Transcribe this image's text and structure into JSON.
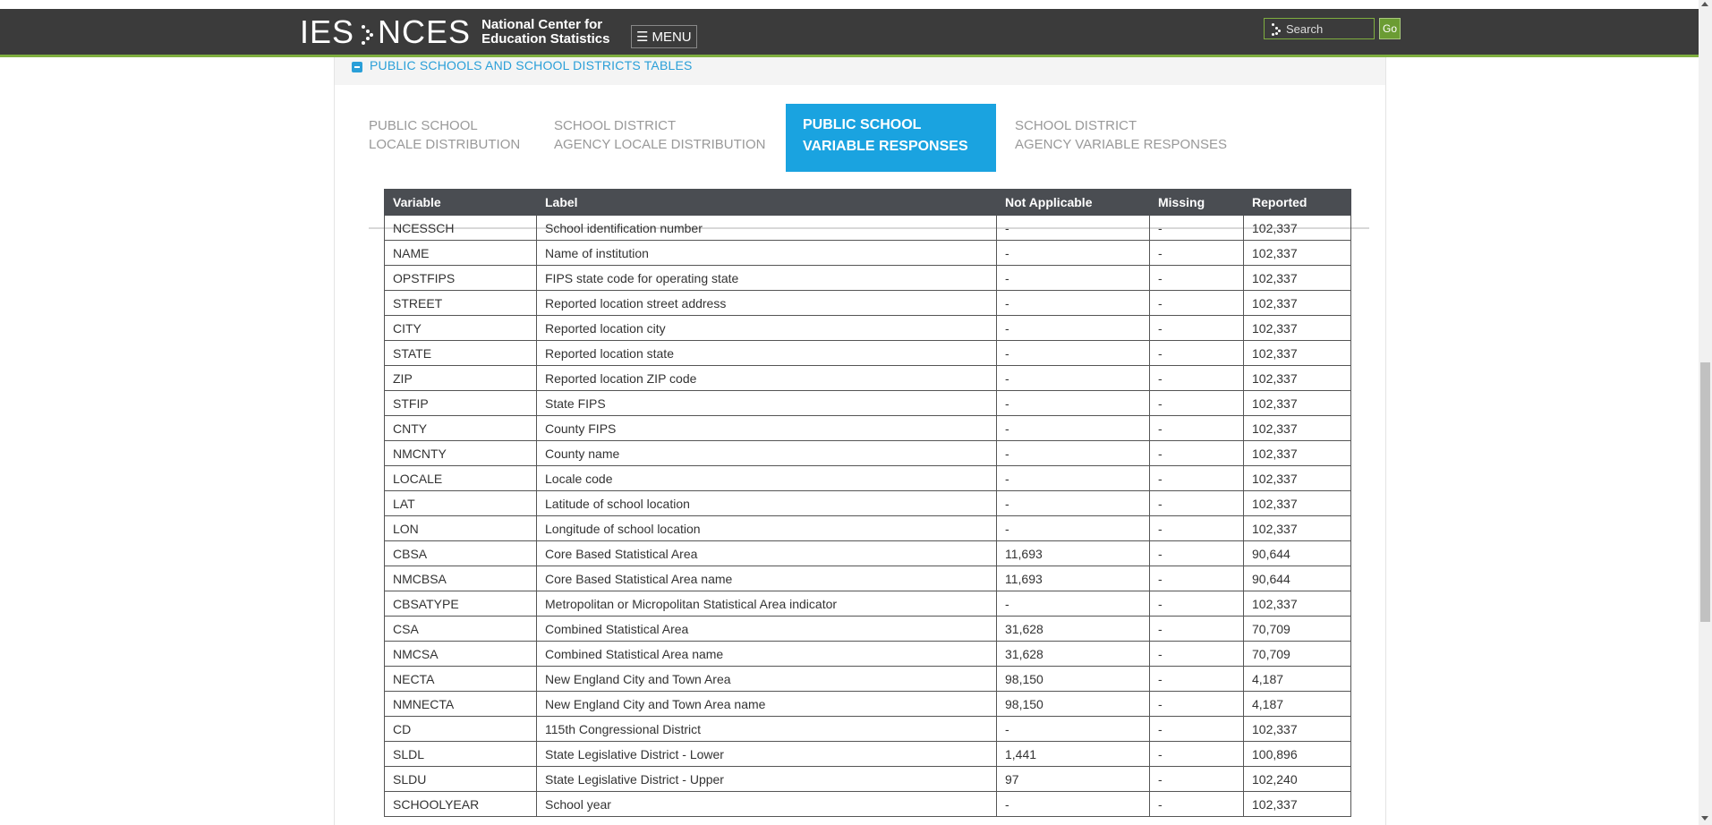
{
  "header": {
    "logo_ies": "IES",
    "logo_nces": "NCES",
    "logo_line1": "National Center for",
    "logo_line2": "Education Statistics",
    "menu_label": "MENU",
    "search_placeholder": "Search",
    "go_label": "Go"
  },
  "section": {
    "title": "PUBLIC SCHOOLS AND SCHOOL DISTRICTS TABLES"
  },
  "tabs": [
    {
      "line1": "PUBLIC SCHOOL",
      "line2": "LOCALE DISTRIBUTION",
      "active": false
    },
    {
      "line1": "SCHOOL DISTRICT",
      "line2": "AGENCY LOCALE DISTRIBUTION",
      "active": false
    },
    {
      "line1": "PUBLIC SCHOOL",
      "line2": "VARIABLE RESPONSES",
      "active": true
    },
    {
      "line1": "SCHOOL DISTRICT",
      "line2": "AGENCY VARIABLE RESPONSES",
      "active": false
    }
  ],
  "table": {
    "headers": [
      "Variable",
      "Label",
      "Not Applicable",
      "Missing",
      "Reported"
    ],
    "rows": [
      [
        "NCESSCH",
        "School identification number",
        "-",
        "-",
        "102,337"
      ],
      [
        "NAME",
        "Name of institution",
        "-",
        "-",
        "102,337"
      ],
      [
        "OPSTFIPS",
        "FIPS state code for operating state",
        "-",
        "-",
        "102,337"
      ],
      [
        "STREET",
        "Reported location street address",
        "-",
        "-",
        "102,337"
      ],
      [
        "CITY",
        "Reported location city",
        "-",
        "-",
        "102,337"
      ],
      [
        "STATE",
        "Reported location state",
        "-",
        "-",
        "102,337"
      ],
      [
        "ZIP",
        "Reported location ZIP code",
        "-",
        "-",
        "102,337"
      ],
      [
        "STFIP",
        "State FIPS",
        "-",
        "-",
        "102,337"
      ],
      [
        "CNTY",
        "County FIPS",
        "-",
        "-",
        "102,337"
      ],
      [
        "NMCNTY",
        "County name",
        "-",
        "-",
        "102,337"
      ],
      [
        "LOCALE",
        "Locale code",
        "-",
        "-",
        "102,337"
      ],
      [
        "LAT",
        "Latitude of school location",
        "-",
        "-",
        "102,337"
      ],
      [
        "LON",
        "Longitude of school location",
        "-",
        "-",
        "102,337"
      ],
      [
        "CBSA",
        "Core Based Statistical Area",
        "11,693",
        "-",
        "90,644"
      ],
      [
        "NMCBSA",
        "Core Based Statistical Area name",
        "11,693",
        "-",
        "90,644"
      ],
      [
        "CBSATYPE",
        "Metropolitan or Micropolitan Statistical Area indicator",
        "-",
        "-",
        "102,337"
      ],
      [
        "CSA",
        "Combined Statistical Area",
        "31,628",
        "-",
        "70,709"
      ],
      [
        "NMCSA",
        "Combined Statistical Area name",
        "31,628",
        "-",
        "70,709"
      ],
      [
        "NECTA",
        "New England City and Town Area",
        "98,150",
        "-",
        "4,187"
      ],
      [
        "NMNECTA",
        "New England City and Town Area name",
        "98,150",
        "-",
        "4,187"
      ],
      [
        "CD",
        "115th Congressional District",
        "-",
        "-",
        "102,337"
      ],
      [
        "SLDL",
        "State Legislative District - Lower",
        "1,441",
        "-",
        "100,896"
      ],
      [
        "SLDU",
        "State Legislative District - Upper",
        "97",
        "-",
        "102,240"
      ],
      [
        "SCHOOLYEAR",
        "School year",
        "-",
        "-",
        "102,337"
      ]
    ]
  }
}
